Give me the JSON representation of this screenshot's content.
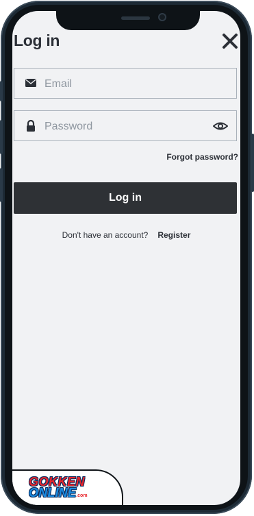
{
  "header": {
    "title": "Log in",
    "close_icon": "close-icon"
  },
  "form": {
    "email": {
      "placeholder": "Email",
      "value": "",
      "icon": "envelope-icon"
    },
    "password": {
      "placeholder": "Password",
      "value": "",
      "icon": "lock-icon",
      "toggle_icon": "eye-icon"
    },
    "forgot_label": "Forgot password?",
    "submit_label": "Log in"
  },
  "register": {
    "prompt": "Don't have an account?",
    "link_label": "Register"
  },
  "brand": {
    "line1": "GOKKEN",
    "line2": "ONLINE",
    "domain": ".com"
  },
  "colors": {
    "background": "#f1f2f4",
    "button": "#2e3135",
    "text": "#2c3037",
    "frame": "#1d2a35"
  }
}
